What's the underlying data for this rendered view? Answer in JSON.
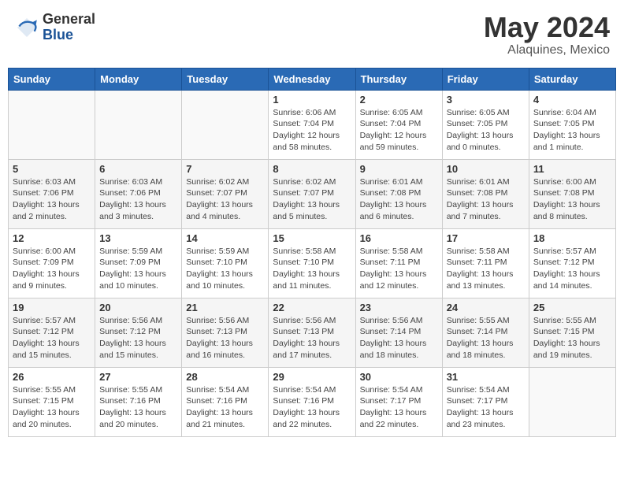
{
  "header": {
    "logo_general": "General",
    "logo_blue": "Blue",
    "month_title": "May 2024",
    "location": "Alaquines, Mexico"
  },
  "weekdays": [
    "Sunday",
    "Monday",
    "Tuesday",
    "Wednesday",
    "Thursday",
    "Friday",
    "Saturday"
  ],
  "weeks": [
    [
      {
        "day": "",
        "info": ""
      },
      {
        "day": "",
        "info": ""
      },
      {
        "day": "",
        "info": ""
      },
      {
        "day": "1",
        "info": "Sunrise: 6:06 AM\nSunset: 7:04 PM\nDaylight: 12 hours\nand 58 minutes."
      },
      {
        "day": "2",
        "info": "Sunrise: 6:05 AM\nSunset: 7:04 PM\nDaylight: 12 hours\nand 59 minutes."
      },
      {
        "day": "3",
        "info": "Sunrise: 6:05 AM\nSunset: 7:05 PM\nDaylight: 13 hours\nand 0 minutes."
      },
      {
        "day": "4",
        "info": "Sunrise: 6:04 AM\nSunset: 7:05 PM\nDaylight: 13 hours\nand 1 minute."
      }
    ],
    [
      {
        "day": "5",
        "info": "Sunrise: 6:03 AM\nSunset: 7:06 PM\nDaylight: 13 hours\nand 2 minutes."
      },
      {
        "day": "6",
        "info": "Sunrise: 6:03 AM\nSunset: 7:06 PM\nDaylight: 13 hours\nand 3 minutes."
      },
      {
        "day": "7",
        "info": "Sunrise: 6:02 AM\nSunset: 7:07 PM\nDaylight: 13 hours\nand 4 minutes."
      },
      {
        "day": "8",
        "info": "Sunrise: 6:02 AM\nSunset: 7:07 PM\nDaylight: 13 hours\nand 5 minutes."
      },
      {
        "day": "9",
        "info": "Sunrise: 6:01 AM\nSunset: 7:08 PM\nDaylight: 13 hours\nand 6 minutes."
      },
      {
        "day": "10",
        "info": "Sunrise: 6:01 AM\nSunset: 7:08 PM\nDaylight: 13 hours\nand 7 minutes."
      },
      {
        "day": "11",
        "info": "Sunrise: 6:00 AM\nSunset: 7:08 PM\nDaylight: 13 hours\nand 8 minutes."
      }
    ],
    [
      {
        "day": "12",
        "info": "Sunrise: 6:00 AM\nSunset: 7:09 PM\nDaylight: 13 hours\nand 9 minutes."
      },
      {
        "day": "13",
        "info": "Sunrise: 5:59 AM\nSunset: 7:09 PM\nDaylight: 13 hours\nand 10 minutes."
      },
      {
        "day": "14",
        "info": "Sunrise: 5:59 AM\nSunset: 7:10 PM\nDaylight: 13 hours\nand 10 minutes."
      },
      {
        "day": "15",
        "info": "Sunrise: 5:58 AM\nSunset: 7:10 PM\nDaylight: 13 hours\nand 11 minutes."
      },
      {
        "day": "16",
        "info": "Sunrise: 5:58 AM\nSunset: 7:11 PM\nDaylight: 13 hours\nand 12 minutes."
      },
      {
        "day": "17",
        "info": "Sunrise: 5:58 AM\nSunset: 7:11 PM\nDaylight: 13 hours\nand 13 minutes."
      },
      {
        "day": "18",
        "info": "Sunrise: 5:57 AM\nSunset: 7:12 PM\nDaylight: 13 hours\nand 14 minutes."
      }
    ],
    [
      {
        "day": "19",
        "info": "Sunrise: 5:57 AM\nSunset: 7:12 PM\nDaylight: 13 hours\nand 15 minutes."
      },
      {
        "day": "20",
        "info": "Sunrise: 5:56 AM\nSunset: 7:12 PM\nDaylight: 13 hours\nand 15 minutes."
      },
      {
        "day": "21",
        "info": "Sunrise: 5:56 AM\nSunset: 7:13 PM\nDaylight: 13 hours\nand 16 minutes."
      },
      {
        "day": "22",
        "info": "Sunrise: 5:56 AM\nSunset: 7:13 PM\nDaylight: 13 hours\nand 17 minutes."
      },
      {
        "day": "23",
        "info": "Sunrise: 5:56 AM\nSunset: 7:14 PM\nDaylight: 13 hours\nand 18 minutes."
      },
      {
        "day": "24",
        "info": "Sunrise: 5:55 AM\nSunset: 7:14 PM\nDaylight: 13 hours\nand 18 minutes."
      },
      {
        "day": "25",
        "info": "Sunrise: 5:55 AM\nSunset: 7:15 PM\nDaylight: 13 hours\nand 19 minutes."
      }
    ],
    [
      {
        "day": "26",
        "info": "Sunrise: 5:55 AM\nSunset: 7:15 PM\nDaylight: 13 hours\nand 20 minutes."
      },
      {
        "day": "27",
        "info": "Sunrise: 5:55 AM\nSunset: 7:16 PM\nDaylight: 13 hours\nand 20 minutes."
      },
      {
        "day": "28",
        "info": "Sunrise: 5:54 AM\nSunset: 7:16 PM\nDaylight: 13 hours\nand 21 minutes."
      },
      {
        "day": "29",
        "info": "Sunrise: 5:54 AM\nSunset: 7:16 PM\nDaylight: 13 hours\nand 22 minutes."
      },
      {
        "day": "30",
        "info": "Sunrise: 5:54 AM\nSunset: 7:17 PM\nDaylight: 13 hours\nand 22 minutes."
      },
      {
        "day": "31",
        "info": "Sunrise: 5:54 AM\nSunset: 7:17 PM\nDaylight: 13 hours\nand 23 minutes."
      },
      {
        "day": "",
        "info": ""
      }
    ]
  ]
}
